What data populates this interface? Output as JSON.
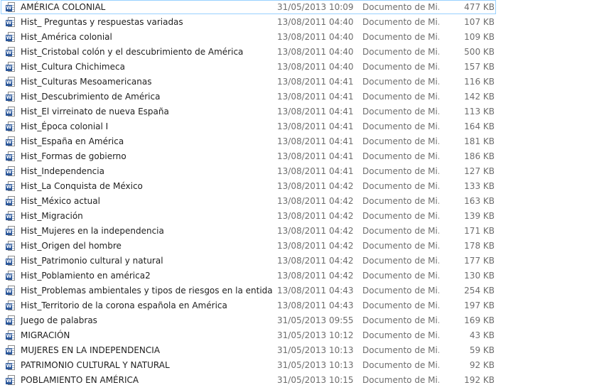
{
  "files": [
    {
      "name": "AMÉRICA COLONIAL",
      "date": "31/05/2013 10:09 ...",
      "type": "Documento de Mi...",
      "size": "477 KB",
      "icon": "word-doc-icon",
      "selected": true
    },
    {
      "name": "Hist_ Preguntas y respuestas variadas",
      "date": "13/08/2011 04:40 a...",
      "type": "Documento de Mi...",
      "size": "107 KB",
      "icon": "word-doc-icon"
    },
    {
      "name": "Hist_América colonial",
      "date": "13/08/2011 04:40 a...",
      "type": "Documento de Mi...",
      "size": "109 KB",
      "icon": "word-doc-icon"
    },
    {
      "name": "Hist_Cristobal colón y el descubrimiento de América",
      "date": "13/08/2011 04:40 a...",
      "type": "Documento de Mi...",
      "size": "500 KB",
      "icon": "word-doc-icon"
    },
    {
      "name": "Hist_Cultura Chichimeca",
      "date": "13/08/2011 04:40 a...",
      "type": "Documento de Mi...",
      "size": "157 KB",
      "icon": "word-doc-icon"
    },
    {
      "name": "Hist_Culturas Mesoamericanas",
      "date": "13/08/2011 04:41 a...",
      "type": "Documento de Mi...",
      "size": "116 KB",
      "icon": "word-doc-icon"
    },
    {
      "name": "Hist_Descubrimiento de América",
      "date": "13/08/2011 04:41 a...",
      "type": "Documento de Mi...",
      "size": "142 KB",
      "icon": "word-doc-icon"
    },
    {
      "name": "Hist_El virreinato de nueva España",
      "date": "13/08/2011 04:41 a...",
      "type": "Documento de Mi...",
      "size": "113 KB",
      "icon": "word-doc-icon"
    },
    {
      "name": "Hist_Época colonial I",
      "date": "13/08/2011 04:41 a...",
      "type": "Documento de Mi...",
      "size": "164 KB",
      "icon": "word-doc-icon"
    },
    {
      "name": "Hist_España en América",
      "date": "13/08/2011 04:41 a...",
      "type": "Documento de Mi...",
      "size": "181 KB",
      "icon": "word-doc-icon"
    },
    {
      "name": "Hist_Formas de gobierno",
      "date": "13/08/2011 04:41 a...",
      "type": "Documento de Mi...",
      "size": "186 KB",
      "icon": "word-doc-icon"
    },
    {
      "name": "Hist_Independencia",
      "date": "13/08/2011 04:41 a...",
      "type": "Documento de Mi...",
      "size": "127 KB",
      "icon": "word-doc-icon"
    },
    {
      "name": "Hist_La Conquista de México",
      "date": "13/08/2011 04:42 a...",
      "type": "Documento de Mi...",
      "size": "133 KB",
      "icon": "word-doc-icon"
    },
    {
      "name": "Hist_México actual",
      "date": "13/08/2011 04:42 a...",
      "type": "Documento de Mi...",
      "size": "163 KB",
      "icon": "word-doc-icon"
    },
    {
      "name": "Hist_Migración",
      "date": "13/08/2011 04:42 a...",
      "type": "Documento de Mi...",
      "size": "139 KB",
      "icon": "word-doc-icon"
    },
    {
      "name": "Hist_Mujeres en la independencia",
      "date": "13/08/2011 04:42 a...",
      "type": "Documento de Mi...",
      "size": "171 KB",
      "icon": "word-doc-icon"
    },
    {
      "name": "Hist_Origen del hombre",
      "date": "13/08/2011 04:42 a...",
      "type": "Documento de Mi...",
      "size": "178 KB",
      "icon": "word-doc-icon"
    },
    {
      "name": "Hist_Patrimonio cultural y natural",
      "date": "13/08/2011 04:42 a...",
      "type": "Documento de Mi...",
      "size": "177 KB",
      "icon": "word-doc-icon"
    },
    {
      "name": "Hist_Poblamiento en américa2",
      "date": "13/08/2011 04:42 a...",
      "type": "Documento de Mi...",
      "size": "130 KB",
      "icon": "word-doc-icon"
    },
    {
      "name": "Hist_Problemas ambientales y tipos de riesgos en la entidad",
      "date": "13/08/2011 04:43 a...",
      "type": "Documento de Mi...",
      "size": "254 KB",
      "icon": "word-doc-icon"
    },
    {
      "name": "Hist_Territorio de la corona española en América",
      "date": "13/08/2011 04:43 a...",
      "type": "Documento de Mi...",
      "size": "197 KB",
      "icon": "word-doc-icon"
    },
    {
      "name": "Juego de palabras",
      "date": "31/05/2013 09:55 ...",
      "type": "Documento de Mi...",
      "size": "169 KB",
      "icon": "word-doc-icon"
    },
    {
      "name": "MIGRACIÓN",
      "date": "31/05/2013 10:12 ...",
      "type": "Documento de Mi...",
      "size": "43 KB",
      "icon": "word-doc-icon"
    },
    {
      "name": "MUJERES EN LA INDEPENDENCIA",
      "date": "31/05/2013 10:13 ...",
      "type": "Documento de Mi...",
      "size": "59 KB",
      "icon": "word-doc-icon"
    },
    {
      "name": "PATRIMONIO CULTURAL Y NATURAL",
      "date": "31/05/2013 10:13 ...",
      "type": "Documento de Mi...",
      "size": "92 KB",
      "icon": "word-doc-icon"
    },
    {
      "name": "POBLAMIENTO EN AMÉRICA",
      "date": "31/05/2013 10:15 ...",
      "type": "Documento de Mi...",
      "size": "192 KB",
      "icon": "word-doc-icon"
    }
  ],
  "colors": {
    "selection_border": "#99d1ff",
    "word_blue": "#2b579a",
    "secondary_text": "#6d6d6d"
  },
  "icon_glyph": "W"
}
